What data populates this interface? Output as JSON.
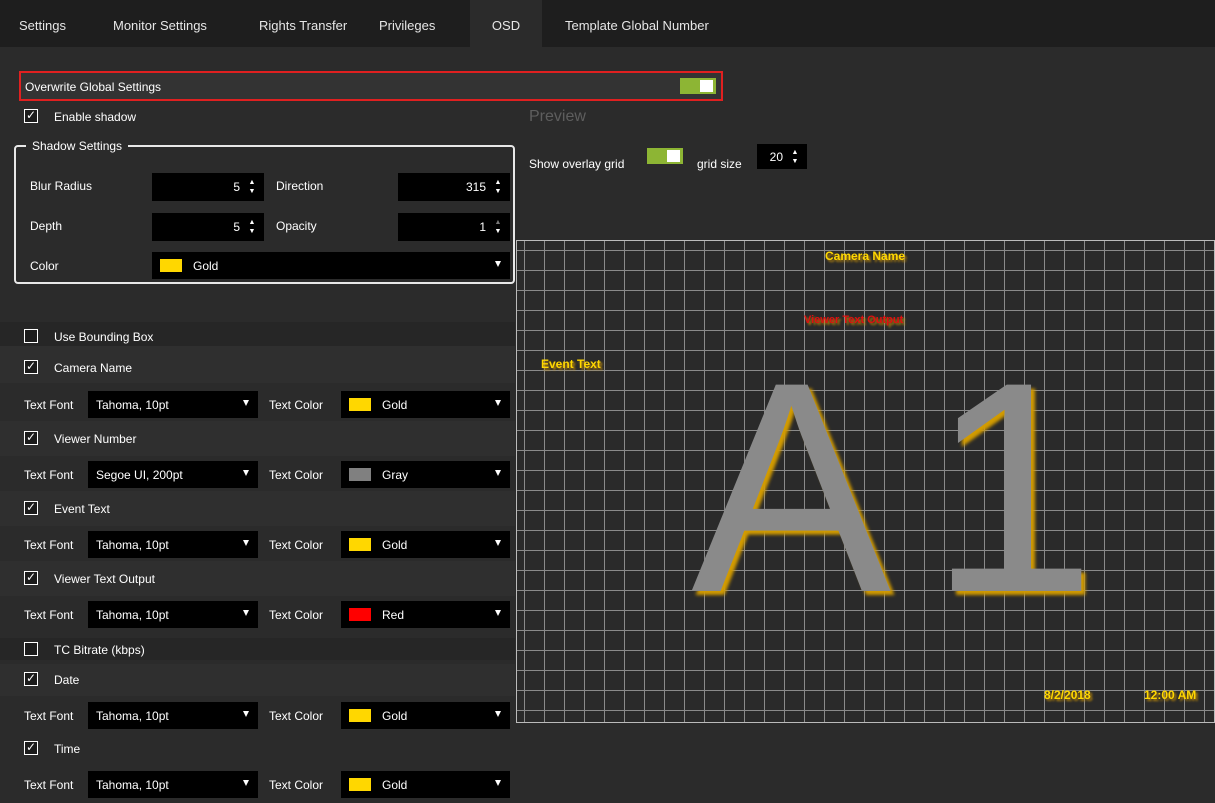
{
  "tabs": [
    {
      "label": "Settings"
    },
    {
      "label": "Monitor Settings"
    },
    {
      "label": "Rights Transfer"
    },
    {
      "label": "Privileges"
    },
    {
      "label": "OSD"
    },
    {
      "label": "Template Global Number"
    }
  ],
  "active_tab": "OSD",
  "overwrite": {
    "label": "Overwrite Global Settings",
    "enabled": true
  },
  "enable_shadow": {
    "label": "Enable shadow",
    "checked": true
  },
  "shadow": {
    "legend": "Shadow Settings",
    "blur_radius": {
      "label": "Blur Radius",
      "value": "5"
    },
    "direction": {
      "label": "Direction",
      "value": "315"
    },
    "depth": {
      "label": "Depth",
      "value": "5"
    },
    "opacity": {
      "label": "Opacity",
      "value": "1"
    },
    "color": {
      "label": "Color",
      "value": "Gold",
      "swatch": "#ffd700"
    }
  },
  "use_bounding_box": {
    "label": "Use Bounding Box",
    "checked": false
  },
  "labels": {
    "text_font": "Text Font",
    "text_color": "Text Color"
  },
  "items": [
    {
      "label": "Camera Name",
      "checked": true,
      "font": "Tahoma, 10pt",
      "color": "Gold",
      "swatch": "#ffd700"
    },
    {
      "label": "Viewer Number",
      "checked": true,
      "font": "Segoe UI, 200pt",
      "color": "Gray",
      "swatch": "#808080"
    },
    {
      "label": "Event Text",
      "checked": true,
      "font": "Tahoma, 10pt",
      "color": "Gold",
      "swatch": "#ffd700"
    },
    {
      "label": "Viewer Text Output",
      "checked": true,
      "font": "Tahoma, 10pt",
      "color": "Red",
      "swatch": "#ff0000"
    }
  ],
  "tc_bitrate": {
    "label": "TC Bitrate (kbps)",
    "checked": false
  },
  "items2": [
    {
      "label": "Date",
      "checked": true,
      "font": "Tahoma, 10pt",
      "color": "Gold",
      "swatch": "#ffd700"
    },
    {
      "label": "Time",
      "checked": true,
      "font": "Tahoma, 10pt",
      "color": "Gold",
      "swatch": "#ffd700"
    }
  ],
  "preview": {
    "title": "Preview",
    "show_grid_label": "Show overlay grid",
    "show_grid": true,
    "grid_size_label": "grid size",
    "grid_size": "20",
    "overlay": {
      "camera_name": "Camera Name",
      "viewer_text": "Viewer Text Output",
      "event_text": "Event Text",
      "viewer_number": "A1",
      "date": "8/2/2018",
      "time": "12:00 AM"
    }
  }
}
